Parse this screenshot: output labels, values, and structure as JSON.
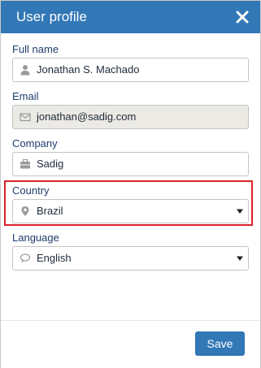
{
  "dialog": {
    "title": "User profile",
    "close_icon": "close-icon"
  },
  "fields": {
    "full_name": {
      "label": "Full name",
      "value": "Jonathan S. Machado",
      "icon": "user-icon"
    },
    "email": {
      "label": "Email",
      "value": "jonathan@sadig.com",
      "icon": "envelope-icon",
      "readonly": true
    },
    "company": {
      "label": "Company",
      "value": "Sadig",
      "icon": "briefcase-icon"
    },
    "country": {
      "label": "Country",
      "value": "Brazil",
      "icon": "map-pin-icon"
    },
    "language": {
      "label": "Language",
      "value": "English",
      "icon": "speech-bubble-icon"
    }
  },
  "footer": {
    "save_label": "Save"
  },
  "colors": {
    "header_bg": "#3277b6",
    "label_text": "#1f3d6b",
    "highlight": "#d8232a",
    "readonly_bg": "#eceae4"
  }
}
